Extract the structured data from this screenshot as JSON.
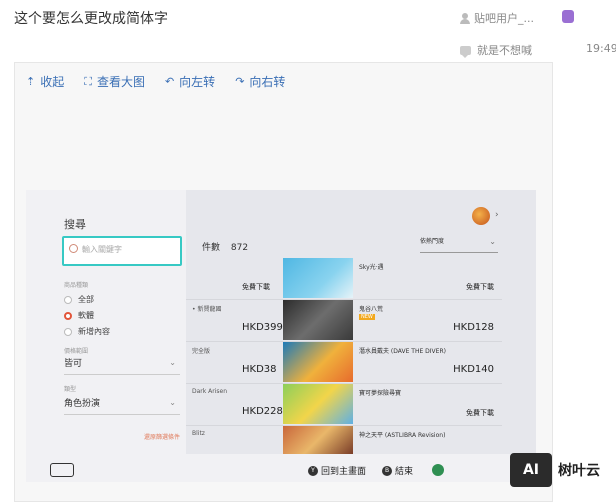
{
  "post": {
    "title": "这个要怎么更改成简体字",
    "author": "贴吧用户_...",
    "reply_user": "就是不想喊",
    "time": "19:49"
  },
  "toolbar": {
    "collapse": "收起",
    "view_large": "查看大图",
    "rotate_left": "向左转",
    "rotate_right": "向右转"
  },
  "screen": {
    "search_title": "搜尋",
    "search_placeholder": "輸入關鍵字",
    "filter_label": "商品種類",
    "radio_all": "全部",
    "radio_software": "軟體",
    "radio_new": "新增內容",
    "price_label": "價格範圍",
    "price_value": "皆可",
    "genre_label": "類型",
    "genre_value": "角色扮演",
    "reset": "還原篩選條件",
    "count_label": "件數",
    "count_value": "872",
    "sort_value": "依熱門度",
    "rows": [
      {
        "left_title": "",
        "left_price": "免費下載",
        "right_title": "Sky光·遇",
        "right_price": "免費下載",
        "new": ""
      },
      {
        "left_title": "• 新賢龍國",
        "left_price": "HKD399",
        "right_title": "鬼谷八荒",
        "right_price": "HKD128",
        "new": "NEW"
      },
      {
        "left_title": "完全版",
        "left_price": "HKD38",
        "right_title": "潛水員戴夫 (DAVE THE DIVER)",
        "right_price": "HKD140",
        "new": ""
      },
      {
        "left_title": "Dark Arisen",
        "left_price": "HKD228",
        "right_title": "寶可夢探險尋寶",
        "right_price": "免費下載",
        "new": ""
      },
      {
        "left_title": "Blitz",
        "left_price": "",
        "right_title": "神之天平 (ASTLIBRA Revision)",
        "right_price": "",
        "new": ""
      }
    ],
    "home_hint": "回到主畫面",
    "end_hint": "結束",
    "btn_y": "Y",
    "btn_b": "B"
  },
  "watermark": {
    "logo": "AI",
    "text": "树叶云"
  },
  "colors": {
    "link": "#3a6fb5",
    "search_border": "#37c9c4",
    "accent": "#e2553a"
  }
}
